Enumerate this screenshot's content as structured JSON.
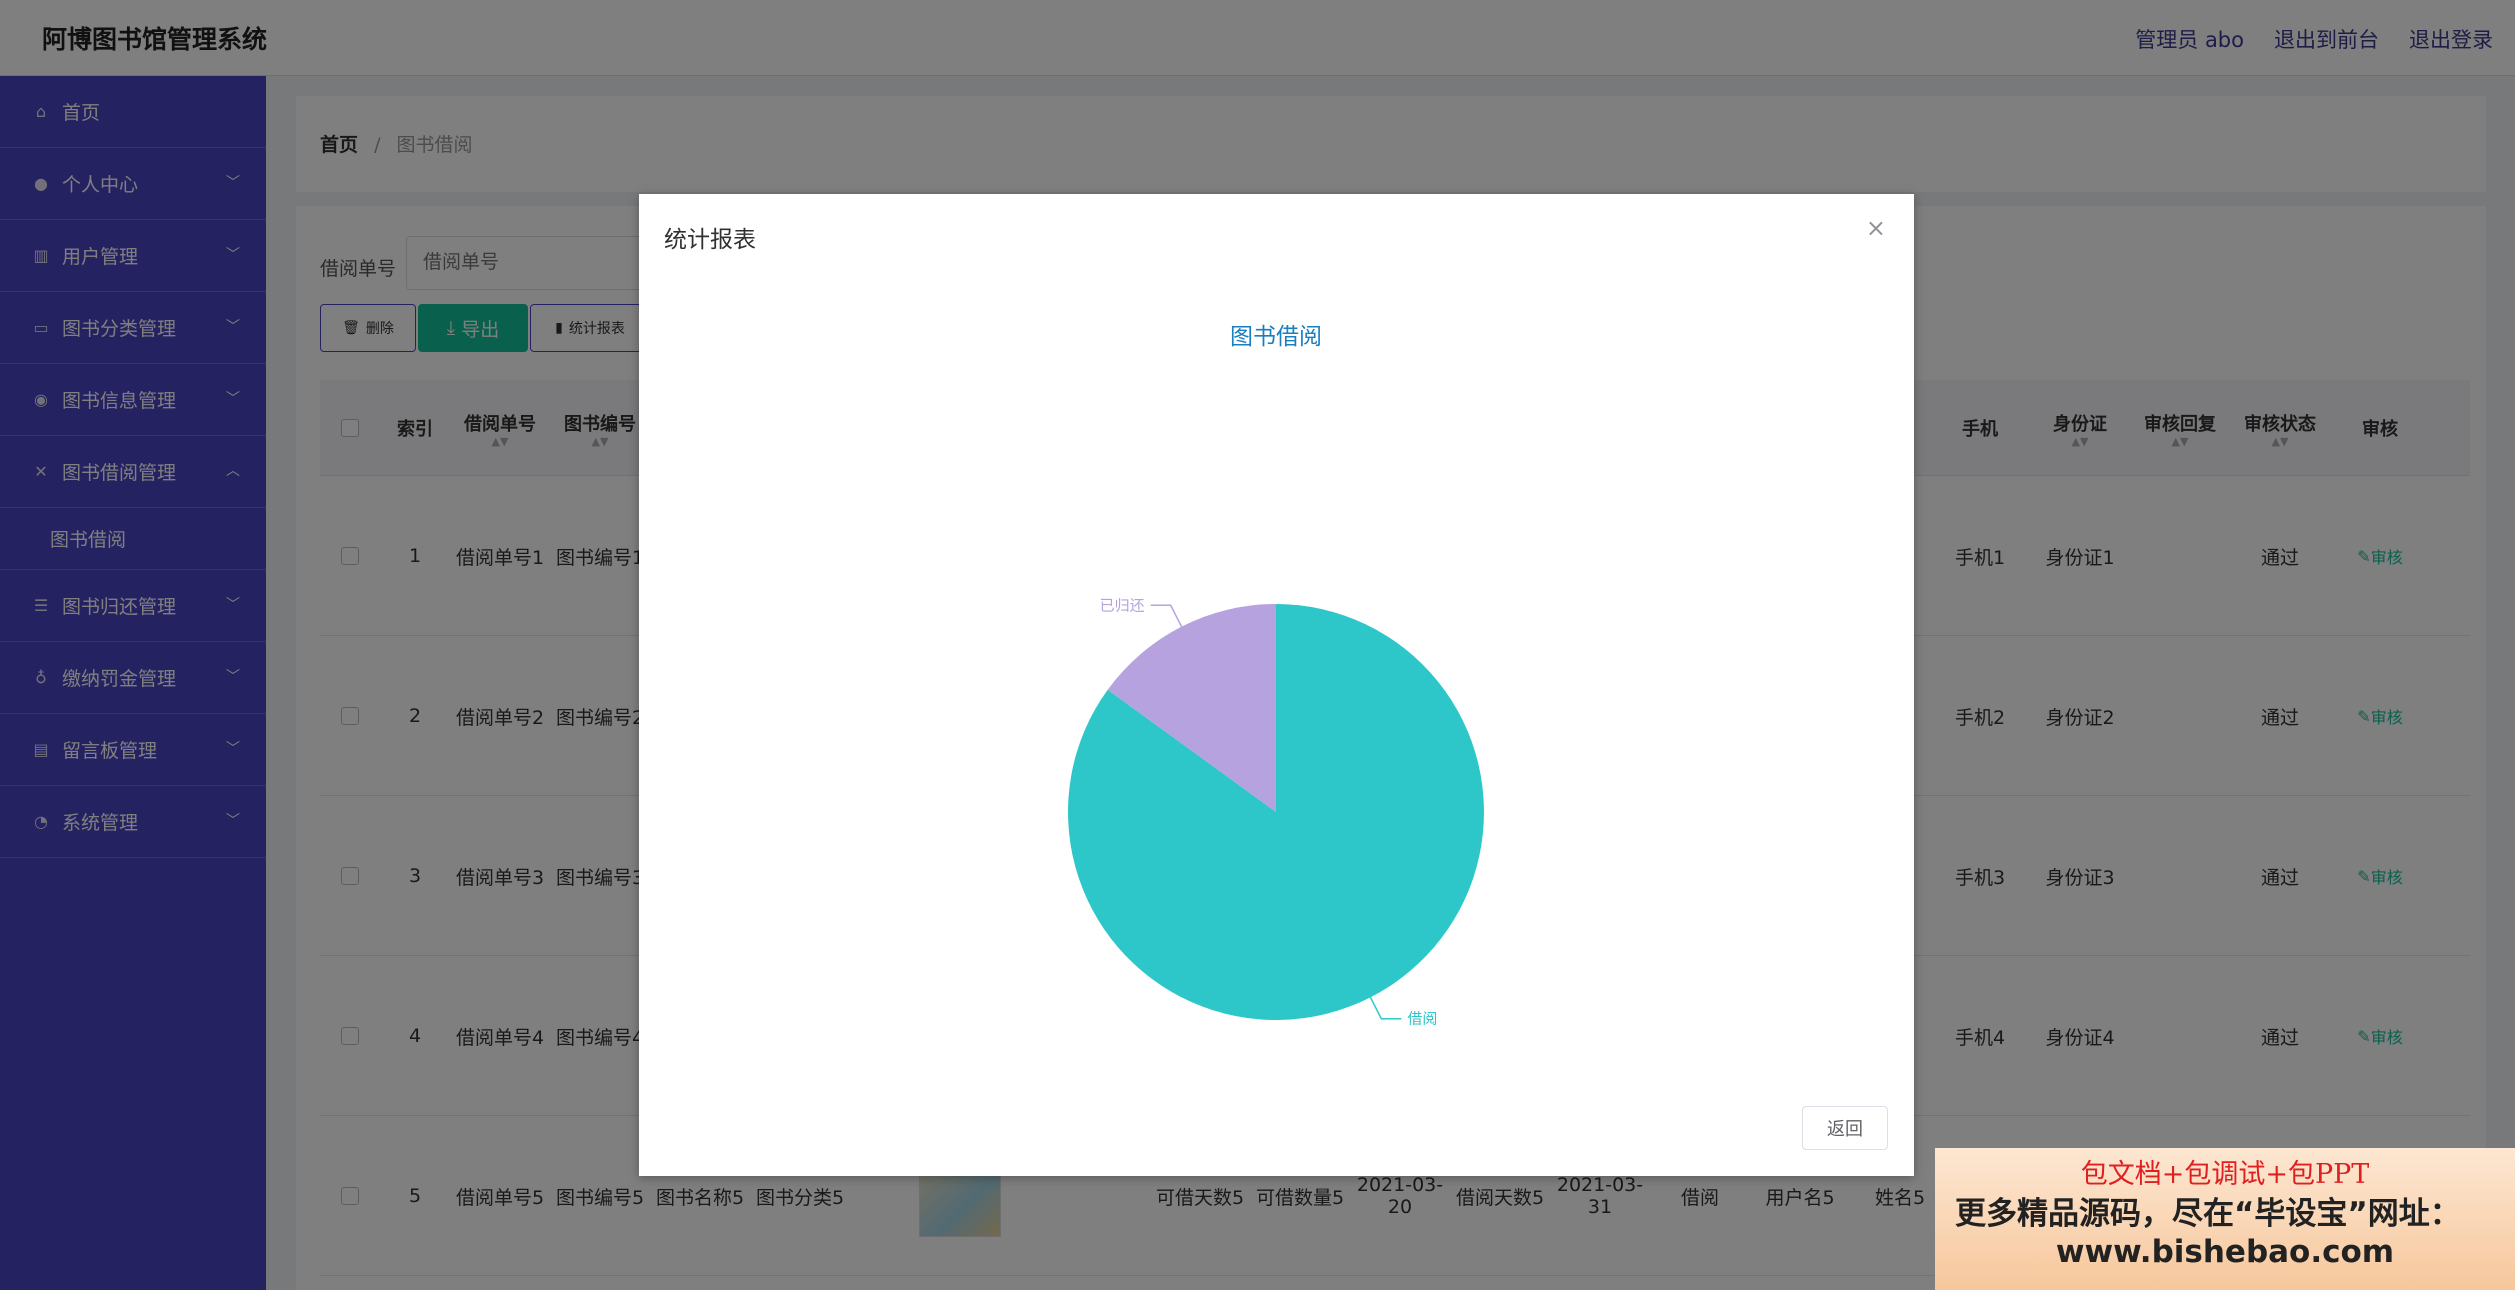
{
  "header": {
    "app_title": "阿博图书馆管理系统",
    "admin_label": "管理员 abo",
    "exit_front": "退出到前台",
    "logout": "退出登录"
  },
  "sidebar": {
    "items": [
      {
        "label": "首页",
        "icon": "home-icon"
      },
      {
        "label": "个人中心",
        "icon": "user-icon"
      },
      {
        "label": "用户管理",
        "icon": "users-icon"
      },
      {
        "label": "图书分类管理",
        "icon": "category-icon"
      },
      {
        "label": "图书信息管理",
        "icon": "location-icon"
      },
      {
        "label": "图书借阅管理",
        "icon": "borrow-icon"
      },
      {
        "label": "图书借阅"
      },
      {
        "label": "图书归还管理",
        "icon": "return-icon"
      },
      {
        "label": "缴纳罚金管理",
        "icon": "fine-icon"
      },
      {
        "label": "留言板管理",
        "icon": "message-icon"
      },
      {
        "label": "系统管理",
        "icon": "settings-icon"
      }
    ]
  },
  "breadcrumb": {
    "home": "首页",
    "sep": "/",
    "current": "图书借阅"
  },
  "search": {
    "label": "借阅单号",
    "placeholder": "借阅单号"
  },
  "toolbar": {
    "delete": "删除",
    "export": "导出",
    "report": "统计报表"
  },
  "table": {
    "headers": {
      "index": "索引",
      "borrow_no": "借阅单号",
      "book_no": "图书编号",
      "phone": "手机",
      "id_card": "身份证",
      "reply": "审核回复",
      "status": "审核状态",
      "audit": "审核"
    },
    "rows": [
      {
        "index": "1",
        "borrow_no": "借阅单号1",
        "book_no": "图书编号1",
        "phone": "手机1",
        "id_card": "身份证1",
        "status": "通过",
        "audit": "审核"
      },
      {
        "index": "2",
        "borrow_no": "借阅单号2",
        "book_no": "图书编号2",
        "phone": "手机2",
        "id_card": "身份证2",
        "status": "通过",
        "audit": "审核"
      },
      {
        "index": "3",
        "borrow_no": "借阅单号3",
        "book_no": "图书编号3",
        "phone": "手机3",
        "id_card": "身份证3",
        "status": "通过",
        "audit": "审核"
      },
      {
        "index": "4",
        "borrow_no": "借阅单号4",
        "book_no": "图书编号4",
        "phone": "手机4",
        "id_card": "身份证4",
        "status": "通过",
        "audit": "审核"
      }
    ],
    "row5": {
      "index": "5",
      "borrow_no": "借阅单号5",
      "book_no": "图书编号5",
      "book_name": "图书名称5",
      "book_cat": "图书分类5",
      "days": "可借天数5",
      "qty": "可借数量5",
      "date1": "2021-03-20",
      "borrow_days": "借阅天数5",
      "date2": "2021-03-31",
      "type": "借阅",
      "username": "用户名5",
      "name": "姓名5"
    }
  },
  "modal": {
    "title": "统计报表",
    "close": "×",
    "return_label": "返回"
  },
  "chart_data": {
    "type": "pie",
    "title": "图书借阅",
    "slices": [
      {
        "label": "借阅",
        "value": 85,
        "color": "#2ec7c9"
      },
      {
        "label": "已归还",
        "value": 15,
        "color": "#b6a2de"
      }
    ]
  },
  "ad": {
    "line1": "包文档+包调试+包PPT",
    "line2": "更多精品源码，尽在“毕设宝”网址：",
    "line3": "www.bishebao.com"
  }
}
